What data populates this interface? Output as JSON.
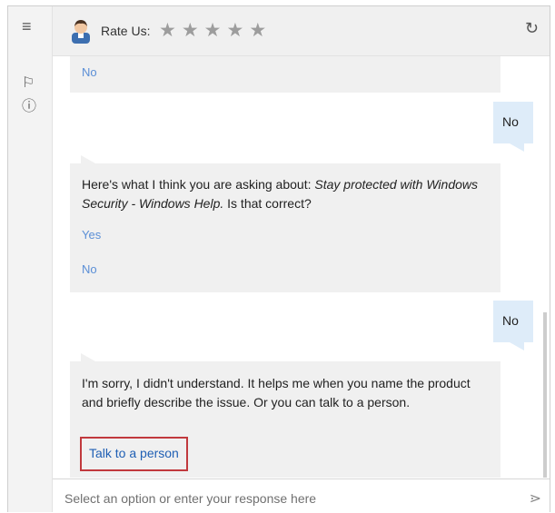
{
  "header": {
    "rate_label": "Rate Us:",
    "star_count": 5,
    "star_glyph": "★",
    "refresh_icon": "refresh-icon",
    "avatar_icon": "agent-avatar-icon"
  },
  "leftrail": {
    "menu_icon": "hamburger-menu-icon",
    "menu_glyph": "≡",
    "feedback_icon": "feedback-icon",
    "feedback_glyph": "⚐",
    "info_icon": "info-icon",
    "info_glyph": "ⓘ"
  },
  "messages": {
    "bot_partial_option": "No",
    "user_reply_1": "No",
    "bot_question_prefix": "Here's what I think you are asking about: ",
    "bot_question_topic": "Stay protected with Windows Security - Windows Help.",
    "bot_question_suffix": " Is that correct?",
    "option_yes": "Yes",
    "option_no": "No",
    "user_reply_2": "No",
    "bot_sorry": "I'm sorry, I didn't understand. It helps me when you name the product and briefly describe the issue. Or you can talk to a person.",
    "talk_link": "Talk to a person"
  },
  "composer": {
    "placeholder": "Select an option or enter your response here",
    "value": "",
    "send_glyph": "⋗"
  },
  "colors": {
    "bot_bubble": "#f0f0f0",
    "user_bubble": "#deecf9",
    "link": "#1f5fb4",
    "highlight_border": "#c1393d"
  }
}
